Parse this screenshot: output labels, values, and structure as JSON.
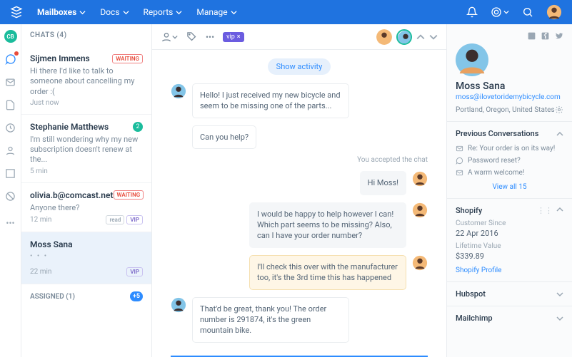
{
  "topnav": {
    "items": [
      "Mailboxes",
      "Docs",
      "Reports",
      "Manage"
    ]
  },
  "rail": {
    "badge": "CB"
  },
  "chatlist": {
    "header": "CHATS (4)",
    "items": [
      {
        "name": "Sijmen Immens",
        "badge": "WAITING",
        "badge_type": "waiting",
        "preview": "Hi there I'd like to talk to someone about cancelling my order :(",
        "time": "Just now"
      },
      {
        "name": "Stephanie Matthews",
        "badge": "2",
        "badge_type": "count",
        "preview": "I'm still wondering why my new subscription doesn't renew at the...",
        "time": "5 min"
      },
      {
        "name": "olivia.b@comcast.net",
        "badge": "WAITING",
        "badge_type": "waiting",
        "preview": "Anyone there?",
        "time": "12 min",
        "pills": [
          "read",
          "VIP"
        ]
      },
      {
        "name": "Moss Sana",
        "selected": true,
        "dots": "• • •",
        "time": "22 min",
        "pills": [
          "VIP"
        ]
      }
    ],
    "assigned": {
      "label": "ASSIGNED (1)",
      "plus": "+5"
    }
  },
  "conversation": {
    "vip_tag": "vip",
    "activity": "Show activity",
    "status": "You accepted the chat",
    "messages": [
      {
        "side": "left",
        "avatar": "moss",
        "text": "Hello! I just received my new bicycle and seem to be missing one of the parts..."
      },
      {
        "side": "left",
        "continuation": true,
        "text": "Can you help?"
      },
      {
        "side": "right",
        "avatar": "agent",
        "style": "gray",
        "text": "Hi Moss!"
      },
      {
        "side": "right",
        "avatar": "agent",
        "style": "gray",
        "text": "I would be happy to help however I can! Which part seems to be missing? Also, can I have your order number?"
      },
      {
        "side": "right",
        "avatar": "agent",
        "style": "note",
        "text": "I'll check this over with the manufacturer too, it's the 3rd time this has happened"
      },
      {
        "side": "left",
        "avatar": "moss",
        "text": "That'd be great, thank you! The order number is 291874, it's the green mountain bike."
      }
    ]
  },
  "side": {
    "name": "Moss Sana",
    "email": "moss@ilovetoridemybicycle.com",
    "location": "Portland, Oregon, United States",
    "prev": {
      "header": "Previous Conversations",
      "items": [
        {
          "icon": "mail",
          "text": "Re: Your order is on its way!"
        },
        {
          "icon": "chat",
          "text": "Password reset?"
        },
        {
          "icon": "mail",
          "text": "A warm welcome!"
        }
      ],
      "viewall": "View all 15"
    },
    "shopify": {
      "header": "Shopify",
      "since_label": "Customer Since",
      "since_val": "22 Apr 2016",
      "ltv_label": "Lifetime Value",
      "ltv_val": "$339.89",
      "link": "Shopify Profile"
    },
    "hubspot": "Hubspot",
    "mailchimp": "Mailchimp"
  }
}
